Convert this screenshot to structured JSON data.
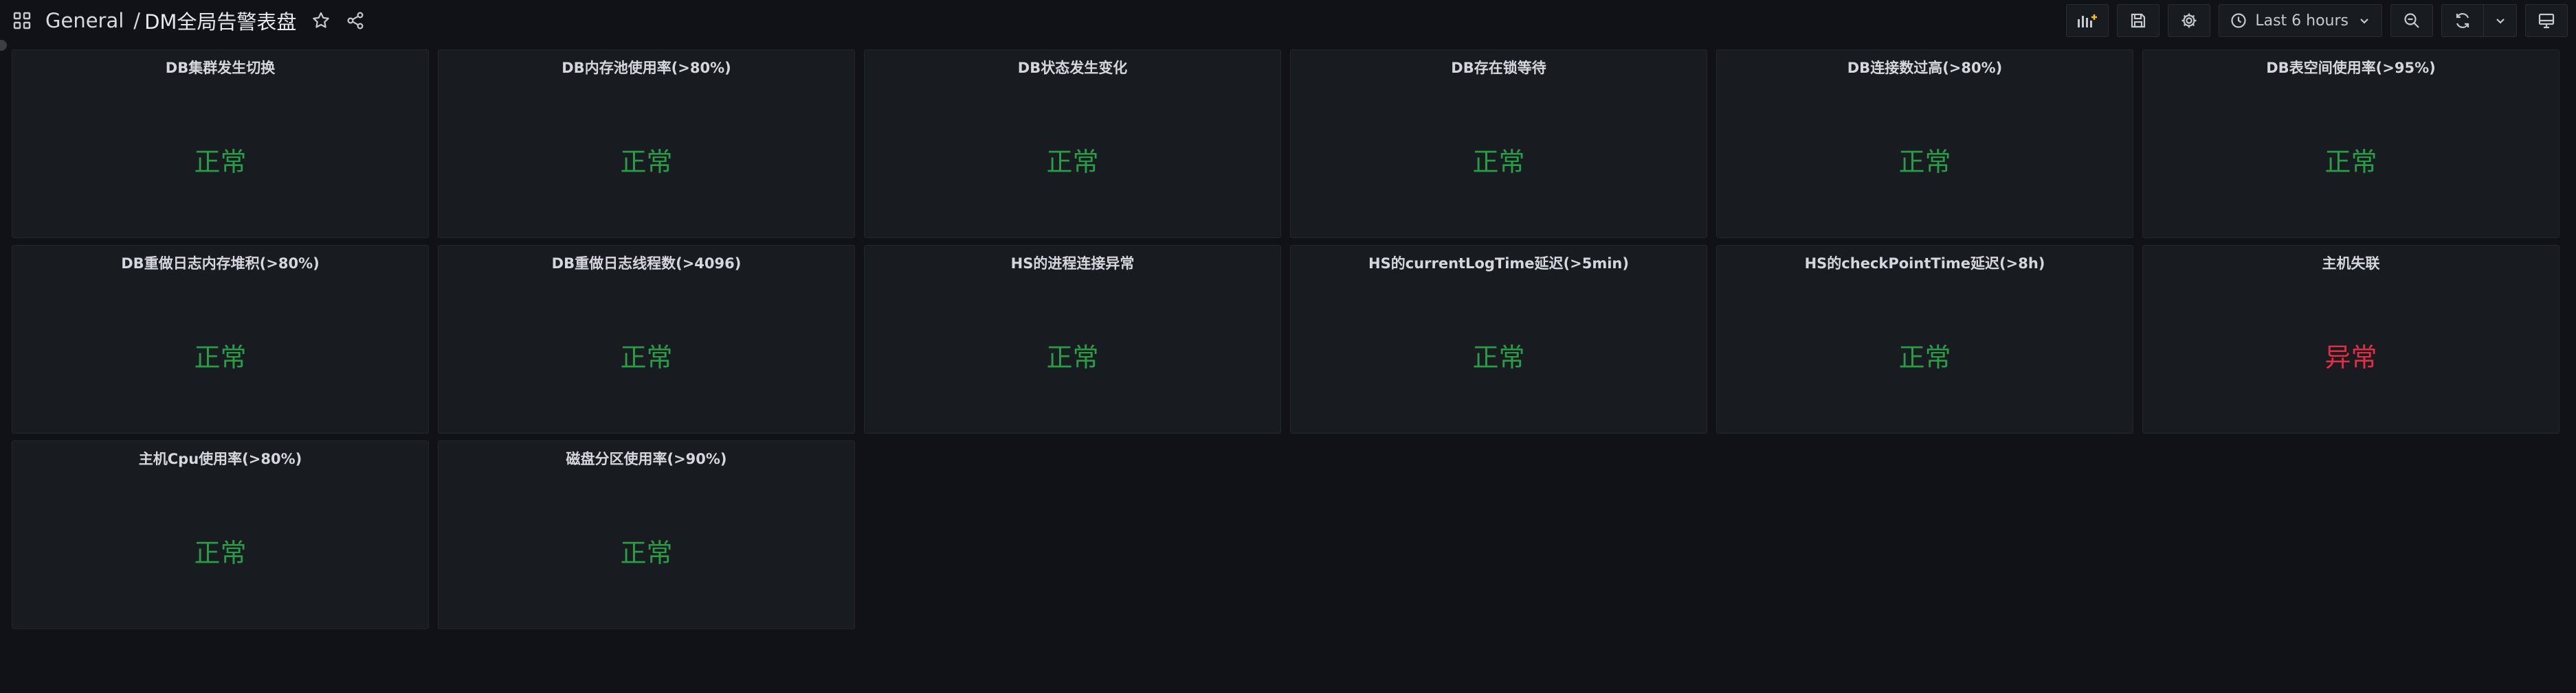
{
  "breadcrumb": {
    "folder": "General",
    "separator": "/",
    "title": "DM全局告警表盘"
  },
  "icons": {
    "apps": "apps-grid-icon",
    "star": "star-icon",
    "share": "share-icon"
  },
  "toolbar": {
    "add_panel": "add-panel-icon",
    "save": "save-icon",
    "settings": "gear-icon",
    "time_range_label": "Last 6 hours",
    "zoom_out": "zoom-out-icon",
    "refresh": "refresh-icon",
    "refresh_interval": "chevron-down-icon",
    "view_mode": "monitor-icon"
  },
  "colors": {
    "ok": "#299c46",
    "alert": "#e02f44",
    "background": "#111217",
    "panel": "#181b1f",
    "accent": "#f5b73b"
  },
  "panels": [
    {
      "title": "DB集群发生切换",
      "status": "正常",
      "state": "ok"
    },
    {
      "title": "DB内存池使用率(>80%)",
      "status": "正常",
      "state": "ok"
    },
    {
      "title": "DB状态发生变化",
      "status": "正常",
      "state": "ok"
    },
    {
      "title": "DB存在锁等待",
      "status": "正常",
      "state": "ok"
    },
    {
      "title": "DB连接数过高(>80%)",
      "status": "正常",
      "state": "ok"
    },
    {
      "title": "DB表空间使用率(>95%)",
      "status": "正常",
      "state": "ok"
    },
    {
      "title": "DB重做日志内存堆积(>80%)",
      "status": "正常",
      "state": "ok"
    },
    {
      "title": "DB重做日志线程数(>4096)",
      "status": "正常",
      "state": "ok"
    },
    {
      "title": "HS的进程连接异常",
      "status": "正常",
      "state": "ok"
    },
    {
      "title": "HS的currentLogTime延迟(>5min)",
      "status": "正常",
      "state": "ok"
    },
    {
      "title": "HS的checkPointTime延迟(>8h)",
      "status": "正常",
      "state": "ok"
    },
    {
      "title": "主机失联",
      "status": "异常",
      "state": "alert"
    },
    {
      "title": "主机Cpu使用率(>80%)",
      "status": "正常",
      "state": "ok"
    },
    {
      "title": "磁盘分区使用率(>90%)",
      "status": "正常",
      "state": "ok"
    }
  ]
}
